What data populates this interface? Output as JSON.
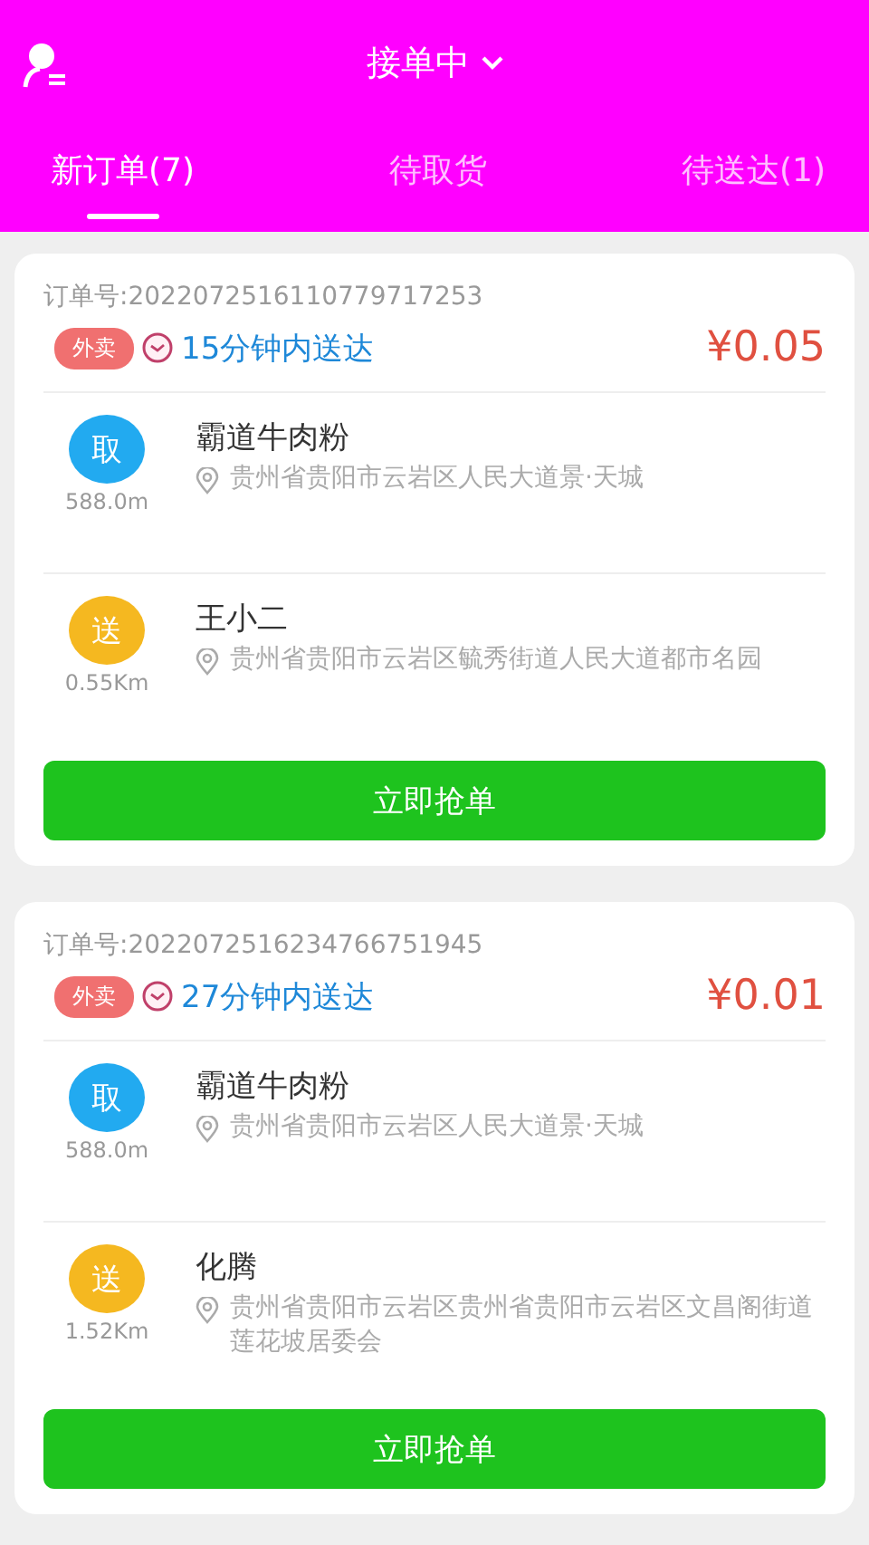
{
  "header": {
    "title": "接单中"
  },
  "tabs": [
    {
      "label": "新订单(7)",
      "selected": true
    },
    {
      "label": "待取货",
      "selected": false
    },
    {
      "label": "待送达(1)",
      "selected": false
    }
  ],
  "orders": [
    {
      "order_no": "订单号:2022072516110779717253",
      "tag": "外卖",
      "eta": "15分钟内送达",
      "price": "¥0.05",
      "stops": [
        {
          "kind": "pickup",
          "badge": "取",
          "distance": "588.0m",
          "name": "霸道牛肉粉",
          "address": "贵州省贵阳市云岩区人民大道景·天城"
        },
        {
          "kind": "deliver",
          "badge": "送",
          "distance": "0.55Km",
          "name": "王小二",
          "address": "贵州省贵阳市云岩区毓秀街道人民大道都市名园"
        }
      ],
      "button": "立即抢单"
    },
    {
      "order_no": "订单号:2022072516234766751945",
      "tag": "外卖",
      "eta": "27分钟内送达",
      "price": "¥0.01",
      "stops": [
        {
          "kind": "pickup",
          "badge": "取",
          "distance": "588.0m",
          "name": "霸道牛肉粉",
          "address": "贵州省贵阳市云岩区人民大道景·天城"
        },
        {
          "kind": "deliver",
          "badge": "送",
          "distance": "1.52Km",
          "name": "化腾",
          "address": "贵州省贵阳市云岩区贵州省贵阳市云岩区文昌阁街道莲花坡居委会"
        }
      ],
      "button": "立即抢单"
    }
  ]
}
